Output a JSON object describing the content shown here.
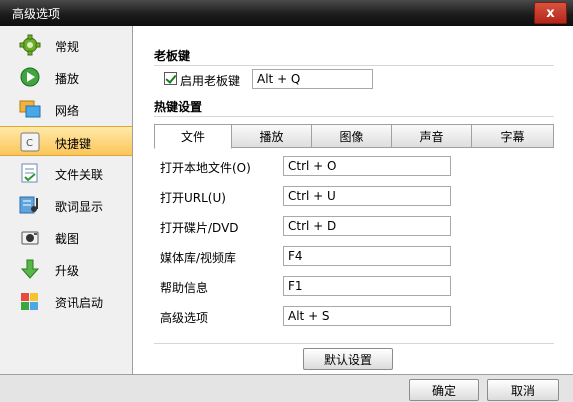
{
  "window": {
    "title": "高级选项",
    "close_label": "x"
  },
  "sidebar": {
    "items": [
      {
        "label": "常规",
        "icon": "gear-icon"
      },
      {
        "label": "播放",
        "icon": "play-icon"
      },
      {
        "label": "网络",
        "icon": "network-icon"
      },
      {
        "label": "快捷键",
        "icon": "keyboard-key-icon"
      },
      {
        "label": "文件关联",
        "icon": "file-association-icon"
      },
      {
        "label": "歌词显示",
        "icon": "lyrics-icon"
      },
      {
        "label": "截图",
        "icon": "camera-icon"
      },
      {
        "label": "升级",
        "icon": "download-arrow-icon"
      },
      {
        "label": "资讯启动",
        "icon": "news-cube-icon"
      }
    ],
    "active_index": 3,
    "active_color": "#fbc659"
  },
  "boss_key": {
    "section_title": "老板键",
    "enable_label": "启用老板键",
    "enabled": true,
    "value": "Alt + Q"
  },
  "hotkeys": {
    "section_title": "热键设置",
    "tabs": [
      "文件",
      "播放",
      "图像",
      "声音",
      "字幕"
    ],
    "active_tab": 0,
    "rows": [
      {
        "label": "打开本地文件(O)",
        "value": "Ctrl + O"
      },
      {
        "label": "打开URL(U)",
        "value": "Ctrl + U"
      },
      {
        "label": "打开碟片/DVD",
        "value": "Ctrl + D"
      },
      {
        "label": "媒体库/视频库",
        "value": "F4"
      },
      {
        "label": "帮助信息",
        "value": "F1"
      },
      {
        "label": "高级选项",
        "value": "Alt + S"
      }
    ],
    "default_button": "默认设置"
  },
  "footer": {
    "ok_label": "确定",
    "cancel_label": "取消"
  }
}
